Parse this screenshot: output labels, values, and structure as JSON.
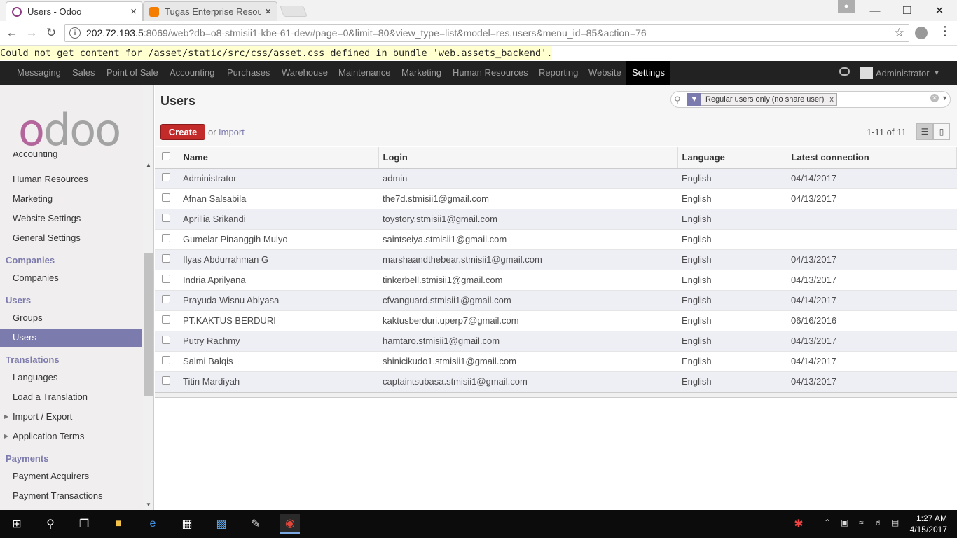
{
  "browser": {
    "tabs": [
      {
        "title": "Users - Odoo",
        "close": "×"
      },
      {
        "title": "Tugas Enterprise Resourc",
        "close": "×"
      }
    ],
    "url_host": "202.72.193.5",
    "url_rest": ":8069/web?db=o8-stmisii1-kbe-61-dev#page=0&limit=80&view_type=list&model=res.users&menu_id=85&action=76"
  },
  "asset_warning": "Could not get content for /asset/static/src/css/asset.css defined in bundle 'web.assets_backend'.",
  "topnav": {
    "items": [
      "Messaging",
      "Sales",
      "Point of Sale",
      "Accounting",
      "Purchases",
      "Warehouse",
      "Maintenance",
      "Marketing",
      "Human Resources",
      "Reporting",
      "Website",
      "Settings"
    ],
    "active": "Settings",
    "user": "Administrator"
  },
  "sidebar": {
    "logo": "odoo",
    "items_top": [
      "Accounting",
      "Human Resources",
      "Marketing",
      "Website Settings",
      "General Settings"
    ],
    "sections": [
      {
        "title": "Companies",
        "items": [
          "Companies"
        ]
      },
      {
        "title": "Users",
        "items": [
          "Groups",
          "Users"
        ]
      },
      {
        "title": "Translations",
        "items": [
          "Languages",
          "Load a Translation",
          "Import / Export",
          "Application Terms"
        ]
      },
      {
        "title": "Payments",
        "items": [
          "Payment Acquirers",
          "Payment Transactions"
        ]
      }
    ],
    "active_item": "Users"
  },
  "control_panel": {
    "title": "Users",
    "facet": "Regular users only (no share user)",
    "facet_remove": "x",
    "create_label": "Create",
    "or_label": "or",
    "import_label": "Import",
    "pager": "1-11 of 11"
  },
  "table": {
    "columns": [
      "Name",
      "Login",
      "Language",
      "Latest connection"
    ],
    "rows": [
      {
        "name": "Administrator",
        "login": "admin",
        "language": "English",
        "latest": "04/14/2017"
      },
      {
        "name": "Afnan Salsabila",
        "login": "the7d.stmisii1@gmail.com",
        "language": "English",
        "latest": "04/13/2017"
      },
      {
        "name": "Aprillia Srikandi",
        "login": "toystory.stmisii1@gmail.com",
        "language": "English",
        "latest": ""
      },
      {
        "name": "Gumelar Pinanggih Mulyo",
        "login": "saintseiya.stmisii1@gmail.com",
        "language": "English",
        "latest": ""
      },
      {
        "name": "Ilyas Abdurrahman G",
        "login": "marshaandthebear.stmisii1@gmail.com",
        "language": "English",
        "latest": "04/13/2017"
      },
      {
        "name": "Indria Aprilyana",
        "login": "tinkerbell.stmisii1@gmail.com",
        "language": "English",
        "latest": "04/13/2017"
      },
      {
        "name": "Prayuda Wisnu Abiyasa",
        "login": "cfvanguard.stmisii1@gmail.com",
        "language": "English",
        "latest": "04/14/2017"
      },
      {
        "name": "PT.KAKTUS BERDURI",
        "login": "kaktusberduri.uperp7@gmail.com",
        "language": "English",
        "latest": "06/16/2016"
      },
      {
        "name": "Putry Rachmy",
        "login": "hamtaro.stmisii1@gmail.com",
        "language": "English",
        "latest": "04/13/2017"
      },
      {
        "name": "Salmi Balqis",
        "login": "shinicikudo1.stmisii1@gmail.com",
        "language": "English",
        "latest": "04/14/2017"
      },
      {
        "name": "Titin Mardiyah",
        "login": "captaintsubasa.stmisii1@gmail.com",
        "language": "English",
        "latest": "04/13/2017"
      }
    ]
  },
  "taskbar": {
    "time": "1:27 AM",
    "date": "4/15/2017"
  },
  "colors": {
    "accent": "#7c7bad",
    "create": "#c32a2a",
    "topbar": "#222222"
  }
}
